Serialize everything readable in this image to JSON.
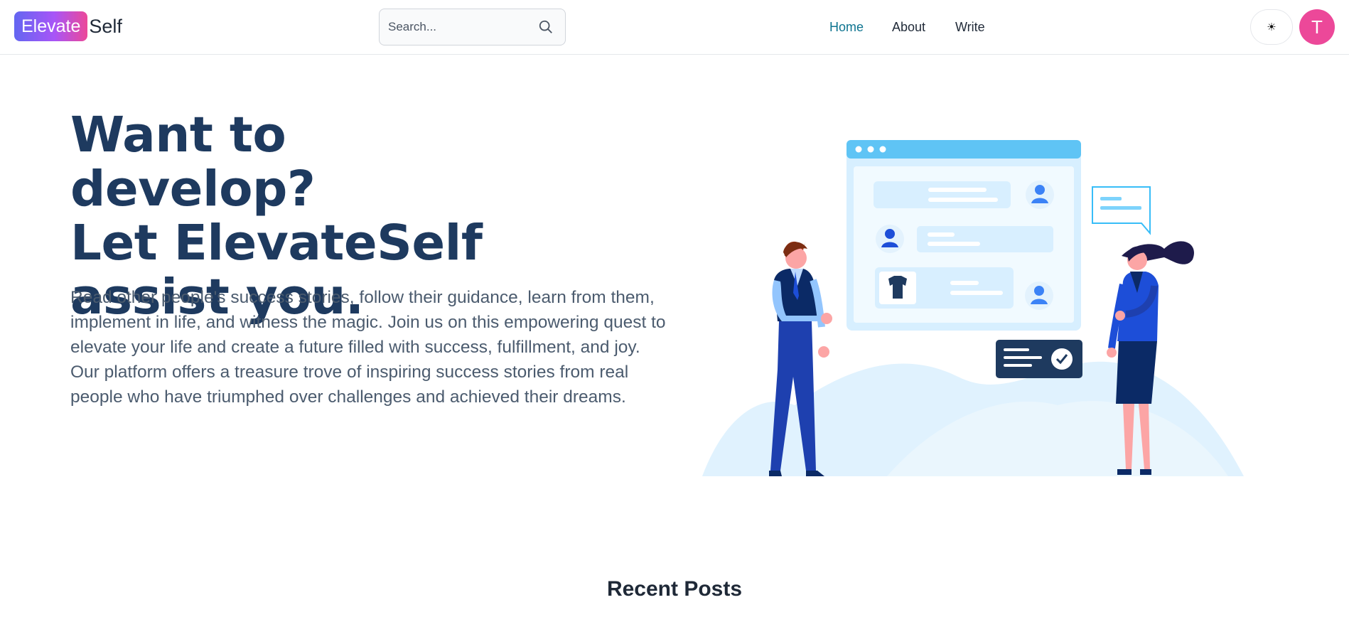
{
  "header": {
    "logo_highlight": "Elevate",
    "logo_rest": "Self",
    "search_placeholder": "Search...",
    "nav": {
      "home": "Home",
      "about": "About",
      "write": "Write"
    },
    "theme_toggle_glyph": "☀",
    "avatar_initial": "T"
  },
  "hero": {
    "title_lines": [
      "Want to develop?",
      "Let ElevateSelf",
      "assist you."
    ],
    "description": "Read other people's success stories, follow their guidance, learn from them, implement in life, and witness the magic. Join us on this empowering quest to elevate your life and create a future filled with success, fulfillment, and joy. Our platform offers a treasure trove of inspiring success stories from real people who have triumphed over challenges and achieved their dreams."
  },
  "sections": {
    "recent_posts_title": "Recent Posts"
  },
  "colors": {
    "accent": "#0e7490",
    "heading": "#1e3a5f",
    "avatar": "#ec4899",
    "logo_gradient": [
      "#6366f1",
      "#a855f7",
      "#ec4899"
    ]
  },
  "icons": [
    "search-icon",
    "sun-icon",
    "chat-illustration"
  ]
}
